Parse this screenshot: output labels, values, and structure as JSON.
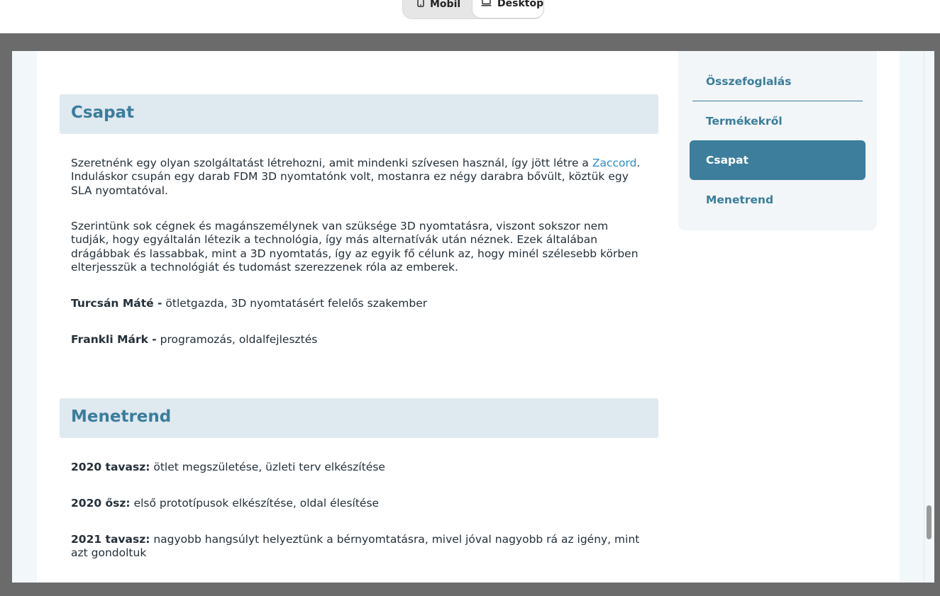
{
  "view_toggle": {
    "mobile_label": "Mobil",
    "desktop_label": "Desktop",
    "selected": "Desktop"
  },
  "sections": {
    "csapat": {
      "title": "Csapat",
      "p1_text": "Szeretnénk egy olyan szolgáltatást létrehozni, amit mindenki szívesen használ, így jött létre a ",
      "p1_link": "Zaccord",
      "p1_rest": ". Induláskor csupán egy darab FDM 3D nyomtatónk volt, mostanra ez négy darabra bővült, köztük egy SLA nyomtatóval.",
      "p2": "Szerintünk sok cégnek és magánszemélynek van szüksége 3D nyomtatásra, viszont sokszor nem tudják, hogy egyáltalán létezik a technológia, így más alternatívák után néznek. Ezek általában drágábbak és lassabbak, mint a 3D nyomtatás, így az egyik fő célunk az, hogy minél szélesebb körben elterjesszük a technológiát és tudomást szerezzenek róla az emberek.",
      "members": [
        {
          "name": "Turcsán Máté -",
          "role": " ötletgazda, 3D nyomtatásért felelős szakember"
        },
        {
          "name": "Frankli Márk -",
          "role": " programozás, oldalfejlesztés"
        }
      ]
    },
    "menetrend": {
      "title": "Menetrend",
      "items": [
        {
          "label": "2020 tavasz:",
          "text": " ötlet megszületése, üzleti terv elkészítése"
        },
        {
          "label": "2020 ősz:",
          "text": " első prototípusok elkészítése, oldal élesítése"
        },
        {
          "label": "2021 tavasz:",
          "text": " nagyobb hangsúlyt helyeztünk a bérnyomtatásra, mivel jóval nagyobb rá az igény, mint azt gondoltuk"
        }
      ]
    }
  },
  "toc": {
    "items": [
      "Összefoglalás",
      "Termékekről",
      "Csapat",
      "Menetrend"
    ],
    "active": "Csapat"
  },
  "colors": {
    "accent": "#3b7d9b",
    "active_bg": "#3c7e9c",
    "section_bg": "#dfe9f0",
    "link": "#2a8fc0",
    "text": "#24303a"
  }
}
